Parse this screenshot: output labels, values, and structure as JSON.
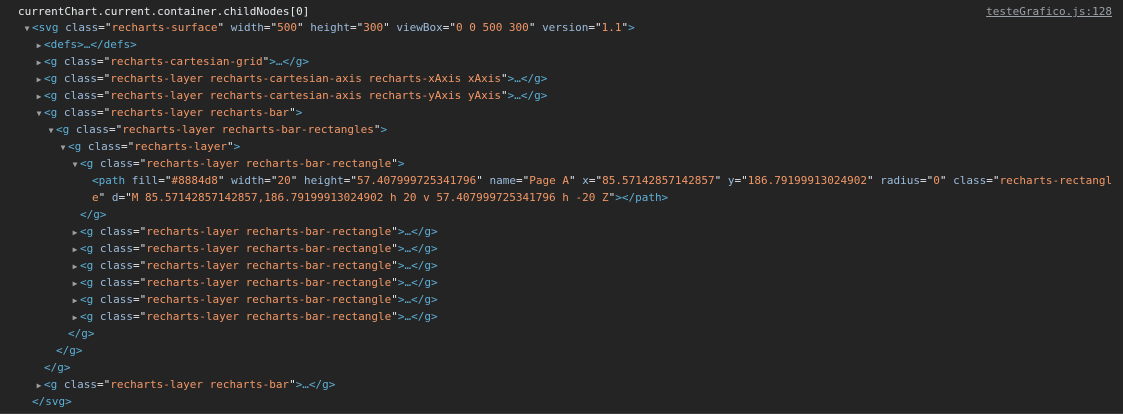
{
  "header": {
    "expression": "currentChart.current.container.childNodes[0]",
    "source_link": "testeGrafico.js:128"
  },
  "nodes": {
    "svg_open": {
      "tag": "<svg",
      "attrs": [
        [
          "class",
          "recharts-surface"
        ],
        [
          "width",
          "500"
        ],
        [
          "height",
          "300"
        ],
        [
          "viewBox",
          "0 0 500 300"
        ],
        [
          "version",
          "1.1"
        ]
      ],
      "close": ">"
    },
    "defs": "<defs>…</defs>",
    "grid": {
      "open": "<g",
      "class": "recharts-cartesian-grid",
      "rest": ">…</g>"
    },
    "xaxis": {
      "open": "<g",
      "class": "recharts-layer recharts-cartesian-axis recharts-xAxis xAxis",
      "rest": ">…</g>"
    },
    "yaxis": {
      "open": "<g",
      "class": "recharts-layer recharts-cartesian-axis recharts-yAxis yAxis",
      "rest": ">…</g>"
    },
    "bar": {
      "open": "<g",
      "class": "recharts-layer recharts-bar",
      "rest": ">"
    },
    "bar_rects": {
      "open": "<g",
      "class": "recharts-layer recharts-bar-rectangles",
      "rest": ">"
    },
    "layer": {
      "open": "<g",
      "class": "recharts-layer",
      "rest": ">"
    },
    "bar_rect_open": {
      "open": "<g",
      "class": "recharts-layer recharts-bar-rectangle",
      "rest": ">"
    },
    "path_line1": {
      "open": "<path",
      "attrs": [
        [
          "fill",
          "#8884d8"
        ],
        [
          "width",
          "20"
        ],
        [
          "height",
          "57.407999725341796"
        ],
        [
          "name",
          "Page A"
        ],
        [
          "x",
          "85.57142857142857"
        ],
        [
          "y",
          "186.79199913024902"
        ],
        [
          "radius",
          "0"
        ]
      ],
      "class_key": "class",
      "class_val_part1": "recharts-rectangl"
    },
    "path_line2": {
      "class_val_part2": "e",
      "d_key": "d",
      "d_val": "M 85.57142857142857,186.79199913024902 h 20 v 57.407999725341796 h -20 Z",
      "close": "></path>"
    },
    "close_g": "</g>",
    "collapsed_rect": {
      "open": "<g",
      "class": "recharts-layer recharts-bar-rectangle",
      "rest": ">…</g>"
    },
    "bar2": {
      "open": "<g",
      "class": "recharts-layer recharts-bar",
      "rest": ">…</g>"
    },
    "svg_close": "</svg>"
  }
}
